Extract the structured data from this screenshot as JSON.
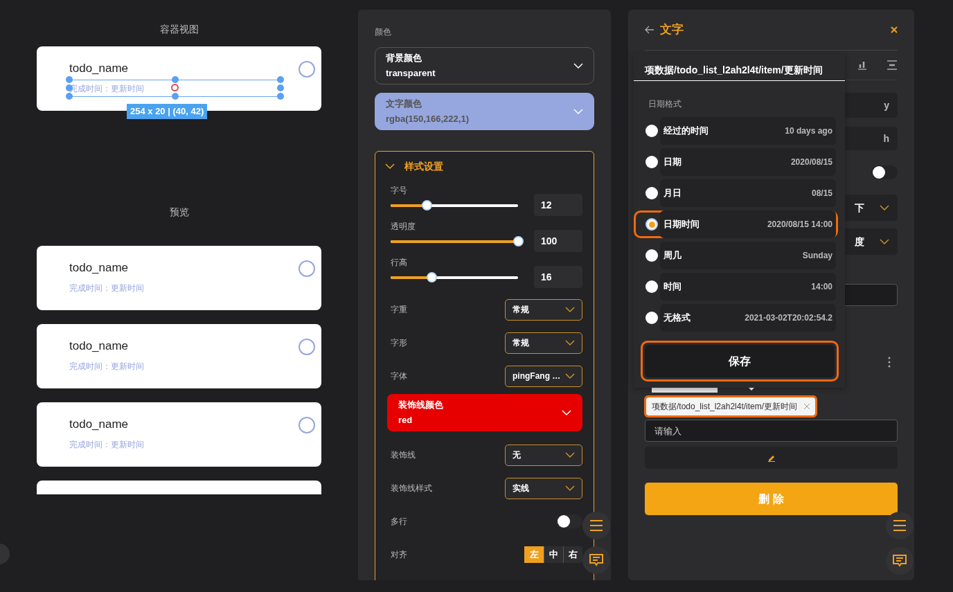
{
  "canvas": {
    "title": "容器视图",
    "card": {
      "name": "todo_name",
      "subtitle": "完成时间：更新时间",
      "done": false
    },
    "selection_label": "254 x 20 | (40, 42)"
  },
  "preview": {
    "title": "预览",
    "cards": [
      {
        "name": "todo_name",
        "subtitle": "完成时间：更新时间",
        "done": false
      },
      {
        "name": "todo_name",
        "subtitle": "完成时间：更新时间",
        "done": false
      },
      {
        "name": "todo_name",
        "subtitle": "完成时间：更新时间",
        "done": false
      }
    ]
  },
  "style_panel": {
    "section_label": "颜色",
    "pickers": [
      {
        "label": "背景颜色",
        "value": "transparent"
      },
      {
        "label": "文字颜色",
        "value": "rgba(150,166,222,1)",
        "color": "#96a6de"
      }
    ],
    "section": {
      "title": "样式设置",
      "expanded": true,
      "sliders": [
        {
          "label": "字号",
          "level": 0.28,
          "value": "12"
        },
        {
          "label": "透明度",
          "level": 1,
          "value": "100"
        },
        {
          "label": "行高",
          "level": 0.32,
          "value": "16"
        }
      ],
      "rows": [
        {
          "kind": "select",
          "label": "字重",
          "value": "常规"
        },
        {
          "kind": "select",
          "label": "字形",
          "value": "常规"
        },
        {
          "kind": "select",
          "label": "字体",
          "value": "pingFang …"
        },
        {
          "kind": "color",
          "label": "装饰线颜色",
          "value": "red",
          "color": "#e60000"
        },
        {
          "kind": "select",
          "label": "装饰线",
          "value": "无"
        },
        {
          "kind": "select",
          "label": "装饰线样式",
          "value": "实线"
        },
        {
          "kind": "toggle",
          "label": "多行",
          "on": false
        },
        {
          "kind": "segmented",
          "label": "对齐",
          "options": [
            {
              "label": "左",
              "selected": true
            },
            {
              "label": "中",
              "selected": false
            },
            {
              "label": "右",
              "selected": false
            }
          ]
        }
      ]
    }
  },
  "editor": {
    "title": "文字",
    "fields": [
      {
        "kind": "suffix",
        "text": "y"
      },
      {
        "kind": "suffix",
        "text": "h"
      },
      {
        "kind": "toggle",
        "on": false
      },
      {
        "kind": "select",
        "text": "下"
      },
      {
        "kind": "select",
        "text": "度"
      },
      {
        "kind": "input"
      }
    ],
    "tags": [
      {
        "text": "项数据/todo_list_l2ah2l4t/item/更新时间",
        "highlighted": true
      }
    ],
    "placeholder": "请输入",
    "delete": "删 除"
  },
  "date_popover": {
    "path": "项数据/todo_list_l2ah2l4t/item/更新时间",
    "section": "日期格式",
    "options": [
      {
        "label": "经过的时间",
        "example": "10 days ago",
        "selected": false
      },
      {
        "label": "日期",
        "example": "2020/08/15",
        "selected": false
      },
      {
        "label": "月日",
        "example": "08/15",
        "selected": false
      },
      {
        "label": "日期时间",
        "example": "2020/08/15 14:00",
        "selected": true
      },
      {
        "label": "周几",
        "example": "Sunday",
        "selected": false
      },
      {
        "label": "时间",
        "example": "14:00",
        "selected": false
      },
      {
        "label": "无格式",
        "example": "2021-03-02T20:02:54.2",
        "selected": false
      }
    ],
    "save": "保存"
  }
}
